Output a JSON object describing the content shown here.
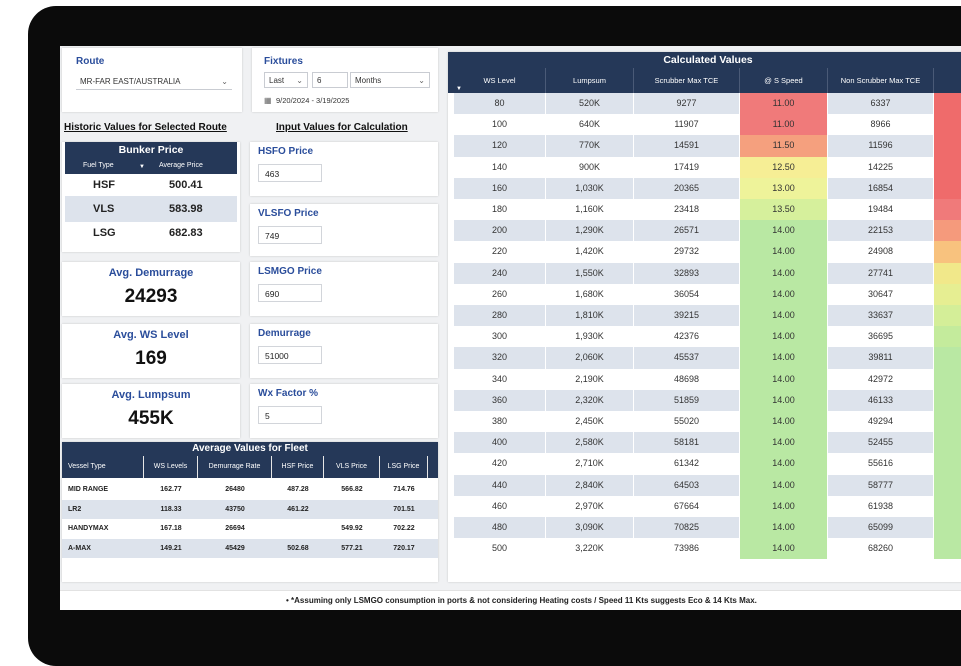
{
  "filters": {
    "route_label": "Route",
    "route_value": "MR-FAR EAST/AUSTRALIA",
    "fixtures_label": "Fixtures",
    "period_mode": "Last",
    "period_count": "6",
    "period_unit": "Months",
    "date_range": "9/20/2024 - 3/19/2025"
  },
  "headings": {
    "historic": "Historic Values for Selected Route",
    "input": "Input Values for Calculation"
  },
  "bunker": {
    "title": "Bunker Price",
    "col_fuel": "Fuel Type",
    "col_avg": "Average Price",
    "rows": [
      {
        "fuel": "HSF",
        "price": "500.41"
      },
      {
        "fuel": "VLS",
        "price": "583.98"
      },
      {
        "fuel": "LSG",
        "price": "682.83"
      }
    ]
  },
  "kpis": {
    "demurrage": {
      "label": "Avg. Demurrage",
      "value": "24293"
    },
    "ws_level": {
      "label": "Avg. WS Level",
      "value": "169"
    },
    "lumpsum": {
      "label": "Avg. Lumpsum",
      "value": "455K"
    }
  },
  "inputs": {
    "hsfo": {
      "label": "HSFO Price",
      "value": "463"
    },
    "vlsfo": {
      "label": "VLSFO Price",
      "value": "749"
    },
    "lsmgo": {
      "label": "LSMGO Price",
      "value": "690"
    },
    "demurrage": {
      "label": "Demurrage",
      "value": "51000"
    },
    "wx": {
      "label": "Wx Factor %",
      "value": "5"
    }
  },
  "fleet": {
    "title": "Average Values for Fleet",
    "headers": [
      "Vessel Type",
      "WS Levels",
      "Demurrage Rate",
      "HSF Price",
      "VLS Price",
      "LSG Price"
    ],
    "rows": [
      [
        "MID RANGE",
        "162.77",
        "26480",
        "487.28",
        "566.82",
        "714.76"
      ],
      [
        "LR2",
        "118.33",
        "43750",
        "461.22",
        "",
        "701.51"
      ],
      [
        "HANDYMAX",
        "167.18",
        "26694",
        "",
        "549.92",
        "702.22"
      ],
      [
        "A-MAX",
        "149.21",
        "45429",
        "502.68",
        "577.21",
        "720.17"
      ]
    ]
  },
  "calc": {
    "title": "Calculated Values",
    "headers": [
      "WS Level",
      "Lumpsum",
      "Scrubber Max TCE",
      "@ S Speed",
      "Non Scrubber Max TCE",
      ""
    ],
    "rows": [
      {
        "ws": "80",
        "lump": "520K",
        "scr": "9277",
        "speed": "11.00",
        "non": "6337",
        "speed_color": "#f07a7a",
        "last_color": "#ef6b6b"
      },
      {
        "ws": "100",
        "lump": "640K",
        "scr": "11907",
        "speed": "11.00",
        "non": "8966",
        "speed_color": "#f07a7a",
        "last_color": "#ef6b6b"
      },
      {
        "ws": "120",
        "lump": "770K",
        "scr": "14591",
        "speed": "11.50",
        "non": "11596",
        "speed_color": "#f5a07e",
        "last_color": "#ef6b6b"
      },
      {
        "ws": "140",
        "lump": "900K",
        "scr": "17419",
        "speed": "12.50",
        "non": "14225",
        "speed_color": "#f6ee95",
        "last_color": "#ef6b6b"
      },
      {
        "ws": "160",
        "lump": "1,030K",
        "scr": "20365",
        "speed": "13.00",
        "non": "16854",
        "speed_color": "#eef39a",
        "last_color": "#ef6b6b"
      },
      {
        "ws": "180",
        "lump": "1,160K",
        "scr": "23418",
        "speed": "13.50",
        "non": "19484",
        "speed_color": "#d6f09c",
        "last_color": "#f07a7a"
      },
      {
        "ws": "200",
        "lump": "1,290K",
        "scr": "26571",
        "speed": "14.00",
        "non": "22153",
        "speed_color": "#b9e8a3",
        "last_color": "#f59a7c"
      },
      {
        "ws": "220",
        "lump": "1,420K",
        "scr": "29732",
        "speed": "14.00",
        "non": "24908",
        "speed_color": "#b9e8a3",
        "last_color": "#f8c27e"
      },
      {
        "ws": "240",
        "lump": "1,550K",
        "scr": "32893",
        "speed": "14.00",
        "non": "27741",
        "speed_color": "#b9e8a3",
        "last_color": "#f1e88a"
      },
      {
        "ws": "260",
        "lump": "1,680K",
        "scr": "36054",
        "speed": "14.00",
        "non": "30647",
        "speed_color": "#b9e8a3",
        "last_color": "#e6ee92"
      },
      {
        "ws": "280",
        "lump": "1,810K",
        "scr": "39215",
        "speed": "14.00",
        "non": "33637",
        "speed_color": "#b9e8a3",
        "last_color": "#d4ee98"
      },
      {
        "ws": "300",
        "lump": "1,930K",
        "scr": "42376",
        "speed": "14.00",
        "non": "36695",
        "speed_color": "#b9e8a3",
        "last_color": "#c4eb9c"
      },
      {
        "ws": "320",
        "lump": "2,060K",
        "scr": "45537",
        "speed": "14.00",
        "non": "39811",
        "speed_color": "#b9e8a3",
        "last_color": "#b9e8a3"
      },
      {
        "ws": "340",
        "lump": "2,190K",
        "scr": "48698",
        "speed": "14.00",
        "non": "42972",
        "speed_color": "#b9e8a3",
        "last_color": "#b9e8a3"
      },
      {
        "ws": "360",
        "lump": "2,320K",
        "scr": "51859",
        "speed": "14.00",
        "non": "46133",
        "speed_color": "#b9e8a3",
        "last_color": "#b9e8a3"
      },
      {
        "ws": "380",
        "lump": "2,450K",
        "scr": "55020",
        "speed": "14.00",
        "non": "49294",
        "speed_color": "#b9e8a3",
        "last_color": "#b9e8a3"
      },
      {
        "ws": "400",
        "lump": "2,580K",
        "scr": "58181",
        "speed": "14.00",
        "non": "52455",
        "speed_color": "#b9e8a3",
        "last_color": "#b9e8a3"
      },
      {
        "ws": "420",
        "lump": "2,710K",
        "scr": "61342",
        "speed": "14.00",
        "non": "55616",
        "speed_color": "#b9e8a3",
        "last_color": "#b9e8a3"
      },
      {
        "ws": "440",
        "lump": "2,840K",
        "scr": "64503",
        "speed": "14.00",
        "non": "58777",
        "speed_color": "#b9e8a3",
        "last_color": "#b9e8a3"
      },
      {
        "ws": "460",
        "lump": "2,970K",
        "scr": "67664",
        "speed": "14.00",
        "non": "61938",
        "speed_color": "#b9e8a3",
        "last_color": "#b9e8a3"
      },
      {
        "ws": "480",
        "lump": "3,090K",
        "scr": "70825",
        "speed": "14.00",
        "non": "65099",
        "speed_color": "#b9e8a3",
        "last_color": "#b9e8a3"
      },
      {
        "ws": "500",
        "lump": "3,220K",
        "scr": "73986",
        "speed": "14.00",
        "non": "68260",
        "speed_color": "#b9e8a3",
        "last_color": "#b9e8a3"
      }
    ]
  },
  "footer": {
    "note": "• *Assuming only LSMGO consumption in ports & not considering Heating costs / Speed 11 Kts suggests Eco & 14 Kts Max."
  },
  "colors": {
    "navy": "#253858",
    "accent_blue": "#2a4d9b",
    "row_alt": "#dde3ec"
  }
}
